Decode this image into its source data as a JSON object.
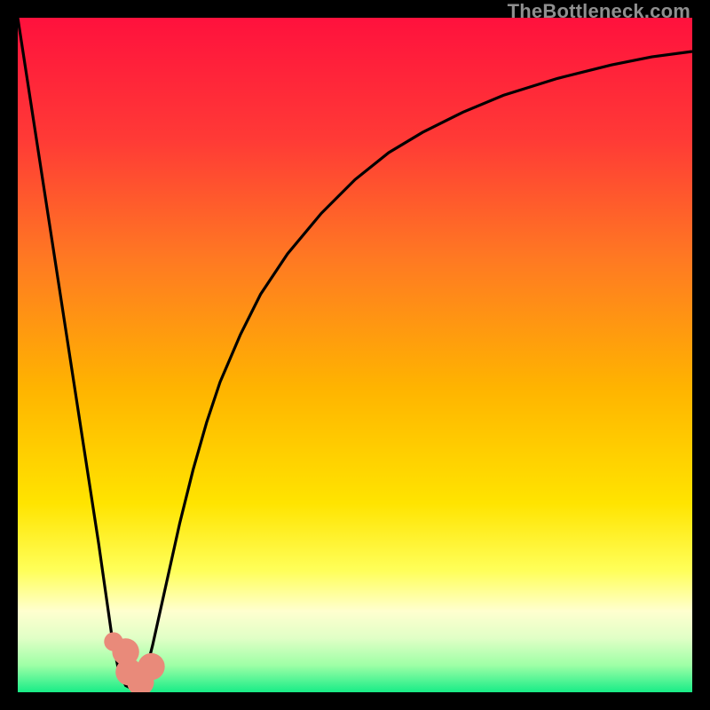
{
  "watermark": "TheBottleneck.com",
  "colors": {
    "gradient_stops": [
      {
        "offset": 0.0,
        "color": "#ff113d"
      },
      {
        "offset": 0.18,
        "color": "#ff3a36"
      },
      {
        "offset": 0.36,
        "color": "#ff7a22"
      },
      {
        "offset": 0.55,
        "color": "#ffb400"
      },
      {
        "offset": 0.72,
        "color": "#ffe400"
      },
      {
        "offset": 0.82,
        "color": "#ffff5a"
      },
      {
        "offset": 0.88,
        "color": "#ffffcf"
      },
      {
        "offset": 0.92,
        "color": "#e0ffc6"
      },
      {
        "offset": 0.96,
        "color": "#9effa6"
      },
      {
        "offset": 1.0,
        "color": "#18ec87"
      }
    ],
    "curve": "#000000",
    "marker_fill": "#e98a7a",
    "marker_stroke": "#d76f5e",
    "frame": "#000000"
  },
  "chart_data": {
    "type": "line",
    "title": "",
    "xlabel": "",
    "ylabel": "",
    "xlim": [
      0,
      100
    ],
    "ylim": [
      0,
      100
    ],
    "grid": false,
    "legend": false,
    "series": [
      {
        "name": "bottleneck-curve",
        "x": [
          0,
          2,
          4,
          6,
          8,
          10,
          12,
          13,
          14,
          15,
          16,
          17,
          18,
          19,
          20,
          22,
          24,
          26,
          28,
          30,
          33,
          36,
          40,
          45,
          50,
          55,
          60,
          66,
          72,
          80,
          88,
          94,
          100
        ],
        "y": [
          100,
          87,
          74,
          61,
          48,
          35,
          22,
          15,
          8,
          3,
          1,
          0.5,
          1,
          3,
          7,
          16,
          25,
          33,
          40,
          46,
          53,
          59,
          65,
          71,
          76,
          80,
          83,
          86,
          88.5,
          91,
          93,
          94.2,
          95
        ]
      }
    ],
    "markers": [
      {
        "name": "small-dot",
        "x": 14.2,
        "y": 7.5,
        "r": 1.4
      },
      {
        "name": "j-blob-start",
        "x": 16.0,
        "y": 6.0,
        "r": 2.0
      },
      {
        "name": "j-blob-mid",
        "x": 16.5,
        "y": 3.0,
        "r": 2.0
      },
      {
        "name": "j-blob-foot",
        "x": 18.2,
        "y": 1.5,
        "r": 2.0
      },
      {
        "name": "j-blob-end",
        "x": 19.8,
        "y": 3.8,
        "r": 2.0
      }
    ],
    "annotations": []
  }
}
